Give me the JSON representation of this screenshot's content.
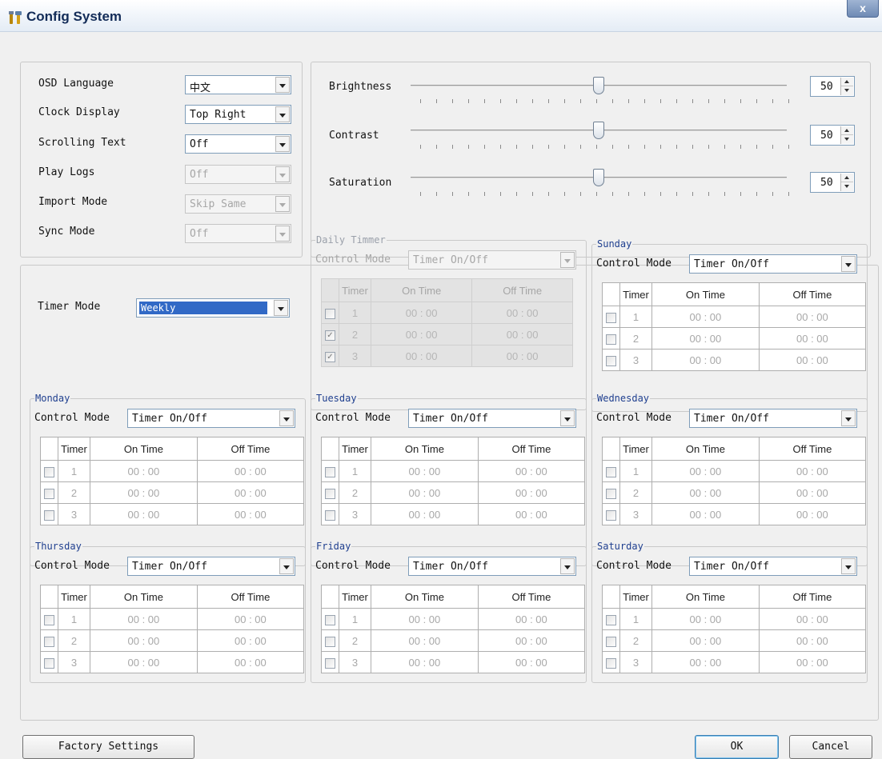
{
  "window": {
    "title": "Config System",
    "close_label": "x",
    "icon": "wrench-tools-icon"
  },
  "settings": {
    "osd_language": {
      "label": "OSD Language",
      "value": "中文",
      "enabled": true
    },
    "clock_display": {
      "label": "Clock Display",
      "value": "Top Right",
      "enabled": true
    },
    "scrolling_text": {
      "label": "Scrolling Text",
      "value": "Off",
      "enabled": true
    },
    "play_logs": {
      "label": "Play Logs",
      "value": "Off",
      "enabled": false
    },
    "import_mode": {
      "label": "Import Mode",
      "value": "Skip Same",
      "enabled": false
    },
    "sync_mode": {
      "label": "Sync Mode",
      "value": "Off",
      "enabled": false
    }
  },
  "picture": {
    "brightness": {
      "label": "Brightness",
      "value": "50",
      "level": 0.5
    },
    "contrast": {
      "label": "Contrast",
      "value": "50",
      "level": 0.5
    },
    "saturation": {
      "label": "Saturation",
      "value": "50",
      "level": 0.5
    }
  },
  "timer": {
    "mode_label": "Timer Mode",
    "mode_value": "Weekly"
  },
  "schedule_labels": {
    "control_mode": "Control Mode",
    "col_timer": "Timer",
    "col_on": "On Time",
    "col_off": "Off Time"
  },
  "schedules": {
    "daily": {
      "title": "Daily Timmer",
      "control_mode": "Timer On/Off",
      "enabled": false,
      "rows": [
        {
          "n": "1",
          "on": "00 : 00",
          "off": "00 : 00",
          "checked": false
        },
        {
          "n": "2",
          "on": "00 : 00",
          "off": "00 : 00",
          "checked": true
        },
        {
          "n": "3",
          "on": "00 : 00",
          "off": "00 : 00",
          "checked": true
        }
      ]
    },
    "sunday": {
      "title": "Sunday",
      "control_mode": "Timer On/Off",
      "enabled": true,
      "rows": [
        {
          "n": "1",
          "on": "00 : 00",
          "off": "00 : 00",
          "checked": false
        },
        {
          "n": "2",
          "on": "00 : 00",
          "off": "00 : 00",
          "checked": false
        },
        {
          "n": "3",
          "on": "00 : 00",
          "off": "00 : 00",
          "checked": false
        }
      ]
    },
    "monday": {
      "title": "Monday",
      "control_mode": "Timer On/Off",
      "enabled": true,
      "rows": [
        {
          "n": "1",
          "on": "00 : 00",
          "off": "00 : 00",
          "checked": false
        },
        {
          "n": "2",
          "on": "00 : 00",
          "off": "00 : 00",
          "checked": false
        },
        {
          "n": "3",
          "on": "00 : 00",
          "off": "00 : 00",
          "checked": false
        }
      ]
    },
    "tuesday": {
      "title": "Tuesday",
      "control_mode": "Timer On/Off",
      "enabled": true,
      "rows": [
        {
          "n": "1",
          "on": "00 : 00",
          "off": "00 : 00",
          "checked": false
        },
        {
          "n": "2",
          "on": "00 : 00",
          "off": "00 : 00",
          "checked": false
        },
        {
          "n": "3",
          "on": "00 : 00",
          "off": "00 : 00",
          "checked": false
        }
      ]
    },
    "wednesday": {
      "title": "Wednesday",
      "control_mode": "Timer On/Off",
      "enabled": true,
      "rows": [
        {
          "n": "1",
          "on": "00 : 00",
          "off": "00 : 00",
          "checked": false
        },
        {
          "n": "2",
          "on": "00 : 00",
          "off": "00 : 00",
          "checked": false
        },
        {
          "n": "3",
          "on": "00 : 00",
          "off": "00 : 00",
          "checked": false
        }
      ]
    },
    "thursday": {
      "title": "Thursday",
      "control_mode": "Timer On/Off",
      "enabled": true,
      "rows": [
        {
          "n": "1",
          "on": "00 : 00",
          "off": "00 : 00",
          "checked": false
        },
        {
          "n": "2",
          "on": "00 : 00",
          "off": "00 : 00",
          "checked": false
        },
        {
          "n": "3",
          "on": "00 : 00",
          "off": "00 : 00",
          "checked": false
        }
      ]
    },
    "friday": {
      "title": "Friday",
      "control_mode": "Timer On/Off",
      "enabled": true,
      "rows": [
        {
          "n": "1",
          "on": "00 : 00",
          "off": "00 : 00",
          "checked": false
        },
        {
          "n": "2",
          "on": "00 : 00",
          "off": "00 : 00",
          "checked": false
        },
        {
          "n": "3",
          "on": "00 : 00",
          "off": "00 : 00",
          "checked": false
        }
      ]
    },
    "saturday": {
      "title": "Saturday",
      "control_mode": "Timer On/Off",
      "enabled": true,
      "rows": [
        {
          "n": "1",
          "on": "00 : 00",
          "off": "00 : 00",
          "checked": false
        },
        {
          "n": "2",
          "on": "00 : 00",
          "off": "00 : 00",
          "checked": false
        },
        {
          "n": "3",
          "on": "00 : 00",
          "off": "00 : 00",
          "checked": false
        }
      ]
    }
  },
  "buttons": {
    "factory": "Factory Settings",
    "ok": "OK",
    "cancel": "Cancel"
  },
  "colors": {
    "title_text": "#132c58",
    "legend_text": "#1f3f8f",
    "selection": "#3169c6",
    "face": "#f0f0f0"
  }
}
